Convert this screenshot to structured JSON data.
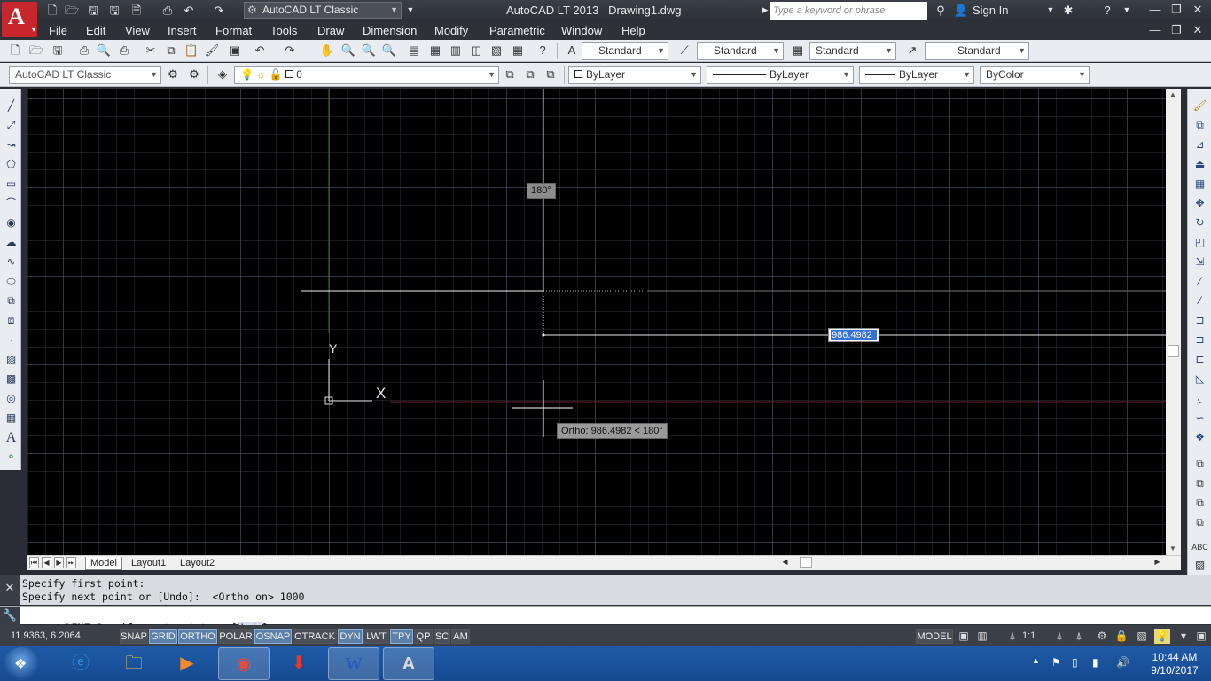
{
  "titlebar": {
    "app_name": "AutoCAD LT 2013",
    "document": "Drawing1.dwg",
    "workspace": "AutoCAD LT Classic",
    "search_placeholder": "Type a keyword or phrase",
    "sign_in": "Sign In"
  },
  "menu": [
    "File",
    "Edit",
    "View",
    "Insert",
    "Format",
    "Tools",
    "Draw",
    "Dimension",
    "Modify",
    "Parametric",
    "Window",
    "Help"
  ],
  "styles_toolbar": {
    "text_style": "Standard",
    "dim_style": "Standard",
    "table_style": "Standard",
    "mleader_style": "Standard"
  },
  "layers_toolbar": {
    "workspace": "AutoCAD LT Classic",
    "layer": "0",
    "color": "ByLayer",
    "linetype": "ByLayer",
    "lineweight": "ByLayer",
    "plot_style": "ByColor"
  },
  "canvas": {
    "polar_tooltip": "180°",
    "dynamic_input": "986.4982",
    "ortho_tooltip": "Ortho: 986.4982 < 180°",
    "ucs_y": "Y",
    "ucs_x": "X"
  },
  "layout_tabs": [
    "Model",
    "Layout1",
    "Layout2"
  ],
  "command": {
    "history": [
      "Specify first point:",
      "Specify next point or [Undo]:  <Ortho on> 1000"
    ],
    "prompt_cmd": "LINE",
    "prompt_text": "Specify next point or [",
    "prompt_option": "Undo",
    "prompt_end": "]:"
  },
  "statusbar": {
    "coords": "11.9363, 6.2064",
    "toggles": [
      {
        "label": "SNAP",
        "on": false
      },
      {
        "label": "GRID",
        "on": true
      },
      {
        "label": "ORTHO",
        "on": true
      },
      {
        "label": "POLAR",
        "on": false
      },
      {
        "label": "OSNAP",
        "on": true
      },
      {
        "label": "OTRACK",
        "on": false
      },
      {
        "label": "DYN",
        "on": true
      },
      {
        "label": "LWT",
        "on": false
      },
      {
        "label": "TPY",
        "on": true
      },
      {
        "label": "QP",
        "on": false
      },
      {
        "label": "SC",
        "on": false
      },
      {
        "label": "AM",
        "on": false
      }
    ],
    "model": "MODEL",
    "scale": "1:1"
  },
  "taskbar": {
    "time": "10:44 AM",
    "date": "9/10/2017"
  },
  "colors": {
    "canvas_bg": "#000000",
    "toggle_on": "#5b7fa8",
    "autocad_red": "#c8262d",
    "dyn_highlight": "#3370d8"
  }
}
